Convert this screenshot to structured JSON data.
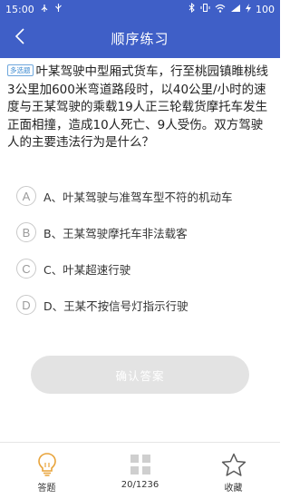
{
  "status_bar": {
    "time": "15:00",
    "left_icons": [
      "tree-icon",
      "usb-icon"
    ],
    "right_icons": [
      "bluetooth-icon",
      "vibrate-icon",
      "wifi-icon",
      "signal-icon",
      "charging-icon"
    ],
    "battery": "100"
  },
  "app_bar": {
    "title": "顺序练习",
    "back_icon": "chevron-left-icon"
  },
  "question": {
    "type_badge": "多选题",
    "text": "叶某驾驶中型厢式货车，行至桃园镇睢桃线3公里加600米弯道路段时，以40公里/小时的速度与王某驾驶的乘载19人正三轮载货摩托车发生正面相撞，造成10人死亡、9人受伤。双方驾驶人的主要违法行为是什么？"
  },
  "options": [
    {
      "letter": "A",
      "text": "A、叶某驾驶与准驾车型不符的机动车"
    },
    {
      "letter": "B",
      "text": "B、王某驾驶摩托车非法载客"
    },
    {
      "letter": "C",
      "text": "C、叶某超速行驶"
    },
    {
      "letter": "D",
      "text": "D、王某不按信号灯指示行驶"
    }
  ],
  "confirm_button": {
    "label": "确认答案"
  },
  "bottom_tabs": [
    {
      "label": "答题",
      "icon": "lightbulb-icon"
    },
    {
      "label": "20/1236",
      "icon": "grid-icon"
    },
    {
      "label": "收藏",
      "icon": "star-icon"
    }
  ],
  "colors": {
    "primary": "#3f5fc7",
    "badge": "#3f8bd1",
    "lightbulb": "#e8a33a",
    "button_disabled": "#e3e3e3"
  }
}
